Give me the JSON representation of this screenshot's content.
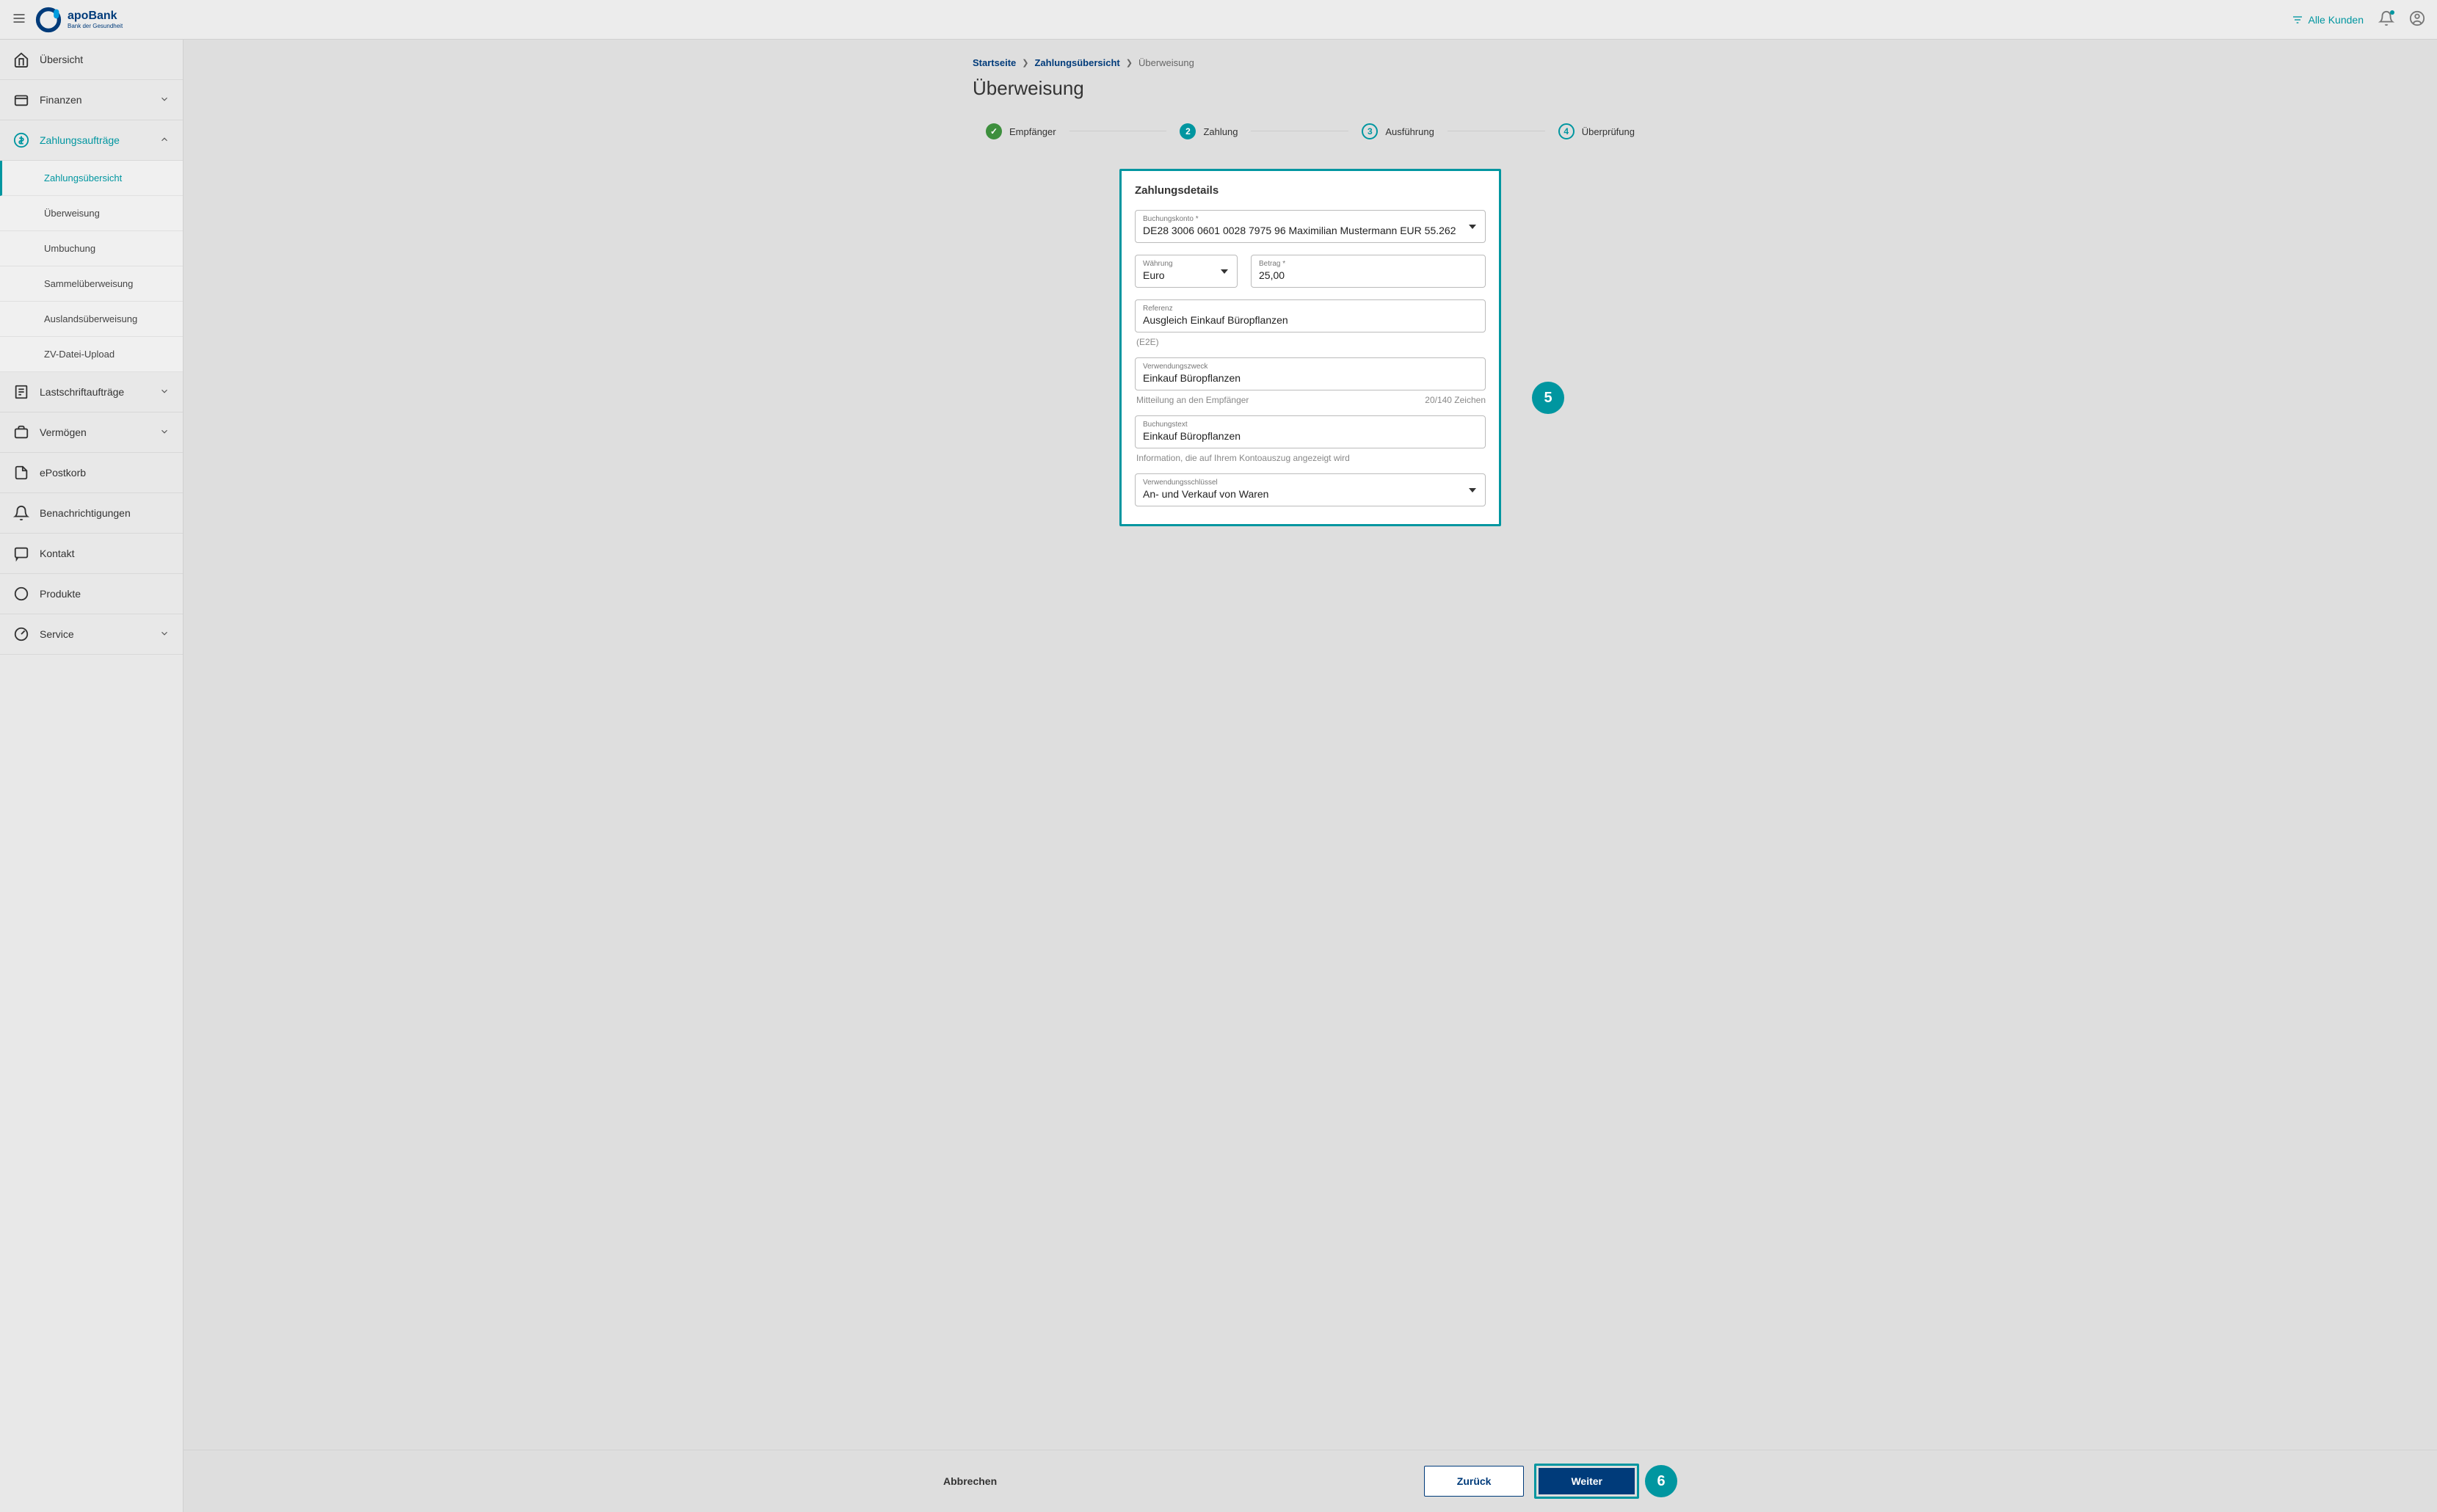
{
  "header": {
    "brand_name": "apoBank",
    "brand_sub": "Bank der Gesundheit",
    "filter_label": "Alle Kunden"
  },
  "sidebar": {
    "items": [
      {
        "label": "Übersicht",
        "icon": "home",
        "expandable": false
      },
      {
        "label": "Finanzen",
        "icon": "wallet",
        "expandable": true
      },
      {
        "label": "Zahlungsaufträge",
        "icon": "dollar-circle",
        "expandable": true,
        "expanded": true,
        "active": true,
        "children": [
          {
            "label": "Zahlungsübersicht",
            "active": true
          },
          {
            "label": "Überweisung"
          },
          {
            "label": "Umbuchung"
          },
          {
            "label": "Sammelüberweisung"
          },
          {
            "label": "Auslandsüberweisung"
          },
          {
            "label": "ZV-Datei-Upload"
          }
        ]
      },
      {
        "label": "Lastschriftaufträge",
        "icon": "doc-list",
        "expandable": true
      },
      {
        "label": "Vermögen",
        "icon": "briefcase",
        "expandable": true
      },
      {
        "label": "ePostkorb",
        "icon": "file",
        "expandable": false
      },
      {
        "label": "Benachrichtigungen",
        "icon": "bell",
        "expandable": false
      },
      {
        "label": "Kontakt",
        "icon": "chat",
        "expandable": false
      },
      {
        "label": "Produkte",
        "icon": "circle",
        "expandable": false
      },
      {
        "label": "Service",
        "icon": "gauge",
        "expandable": true
      }
    ]
  },
  "breadcrumbs": {
    "items": [
      "Startseite",
      "Zahlungsübersicht"
    ],
    "current": "Überweisung"
  },
  "page_title": "Überweisung",
  "stepper": [
    {
      "label": "Empfänger",
      "state": "done"
    },
    {
      "label": "Zahlung",
      "state": "active",
      "num": "2"
    },
    {
      "label": "Ausführung",
      "state": "pending",
      "num": "3"
    },
    {
      "label": "Überprüfung",
      "state": "pending",
      "num": "4"
    }
  ],
  "form": {
    "card_title": "Zahlungsdetails",
    "account_label": "Buchungskonto *",
    "account_value": "DE28 3006 0601 0028 7975 96 Maximilian Mustermann EUR 55.262",
    "currency_label": "Währung",
    "currency_value": "Euro",
    "amount_label": "Betrag *",
    "amount_value": "25,00",
    "reference_label": "Referenz",
    "reference_value": "Ausgleich Einkauf Büropflanzen",
    "reference_hint": "(E2E)",
    "purpose_label": "Verwendungszweck",
    "purpose_value": "Einkauf Büropflanzen",
    "purpose_hint_left": "Mitteilung an den Empfänger",
    "purpose_hint_right": "20/140 Zeichen",
    "booking_label": "Buchungstext",
    "booking_value": "Einkauf Büropflanzen",
    "booking_hint": "Information, die auf Ihrem Kontoauszug angezeigt wird",
    "key_label": "Verwendungsschlüssel",
    "key_value": "An- und Verkauf von Waren"
  },
  "footer": {
    "cancel": "Abbrechen",
    "back": "Zurück",
    "next": "Weiter"
  },
  "annotations": {
    "badge5": "5",
    "badge6": "6"
  }
}
